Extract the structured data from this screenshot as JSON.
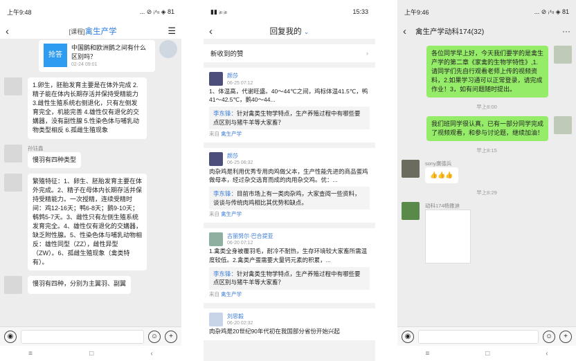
{
  "p1": {
    "status_time": "上午9:48",
    "status_icons": "... ⊘ ᵢ⁴ₗₗ ◈ 81",
    "tag": "[课程]",
    "title": "禽生产学",
    "answer_label": "抢答",
    "question": "中国鹅和欧洲鹅之间有什么区别吗？",
    "question_time": "02-24 09:01",
    "msg1": "1.卵生，胚胎发育主要是在体外完成 2.精子能在体内长期存活并保持受精能力 3.雌性生殖系统右侧退化，只有左侧发育完全，机能完善 4.雄性仅有退化的交媾器，没有副性腺 5.性染色体与哺乳动物类型相反 6.孤雌生殖现象",
    "name2": "孙钰鑫",
    "msg2": "慢羽有四种类型",
    "msg3": "繁殖特征：1、卵生、胚胎发育主要在体外完成。2、精子在母体内长期存活并保持受精能力。一次授精，连续受精时间：鸡12-16天；鸭6-8天；鹅9-10天；鹌鹑5-7天。3、雌性只有左侧生殖系统发育完全。4、雄性仅有退化的交媾器，缺乏附性腺。5、性染色体与哺乳动物相反：雄性同型（ZZ），雌性异型（ZW）。6、孤雌生殖现象（禽类特有）。",
    "msg4": "慢羽有四种，分别为主翼羽、副翼"
  },
  "p2": {
    "status_time": "15:33",
    "title": "回复我的",
    "new_likes": "新收到的赞",
    "cards": [
      {
        "name": "颜莎",
        "time": "06-25 07:12",
        "text": "1、体温高，代谢旺盛。40～44℃之间，鸡标体温41.5℃，鸭41～42.5℃，鹅40～44...",
        "quote_name": "李东锋：",
        "quote": "针对禽类生物学特点，生产养殖过程中有哪些要点区别与猪牛羊等大家畜？",
        "from_label": "来自",
        "from": "禽生产学"
      },
      {
        "name": "颜莎",
        "time": "06-25 06:32",
        "text": "肉杂鸡是利用优秀专用肉鸡做父本，生产性能先进的商品蛋鸡做母本，经过杂交选育而成的肉用杂交鸡。优：...",
        "quote_name": "李东锋：",
        "quote": "目前市场上有一类肉杂鸡，大家查阅一些资料，谈谈与传统肉鸡相比其优势和缺点。",
        "from_label": "来自",
        "from": "禽生产学"
      },
      {
        "name": "古丽努尔·巴合提亚",
        "time": "06-20 07:12",
        "text": "1.禽类全身被覆羽毛，耐冷不耐热，生存环境较大家畜所需温度较低。2.禽类产蛋需要大量钙元素的积累，...",
        "quote_name": "李东锋：",
        "quote": "针对禽类生物学特点，生产养殖过程中有哪些要点区别与猪牛羊等大家畜？",
        "from_label": "来自",
        "from": "禽生产学"
      },
      {
        "name": "刘思毅",
        "time": "06-20 02:32",
        "text": "肉杂鸡是20世纪90年代初在我国部分省份开始兴起",
        "quote_name": "",
        "quote": "",
        "from_label": "",
        "from": ""
      }
    ]
  },
  "p3": {
    "status_time": "上午9:46",
    "status_icons": "... ⊘ ᵢ⁴ₗₗ ◈ 81",
    "title": "禽生产学动科174(32)",
    "msg1": "各位同学早上好，今天我们要学的是禽生产学的第二章《家禽的生物学特性》,1.请同学们先自行观看老师上传的视频资料，2.如果学习通可以正常登录，请完成作业！3，如有问题随时提出。",
    "time1": "早上8:00",
    "msg2": "我们班同学很认真，已有一部分同学完成了视频观看，和参与讨论题，继续加油！",
    "time2": "早上8:15",
    "name3": "sony廣德兵",
    "msg3": "👍👍👍",
    "time3": "早上8:29",
    "name4": "动科174杨雅迪"
  }
}
